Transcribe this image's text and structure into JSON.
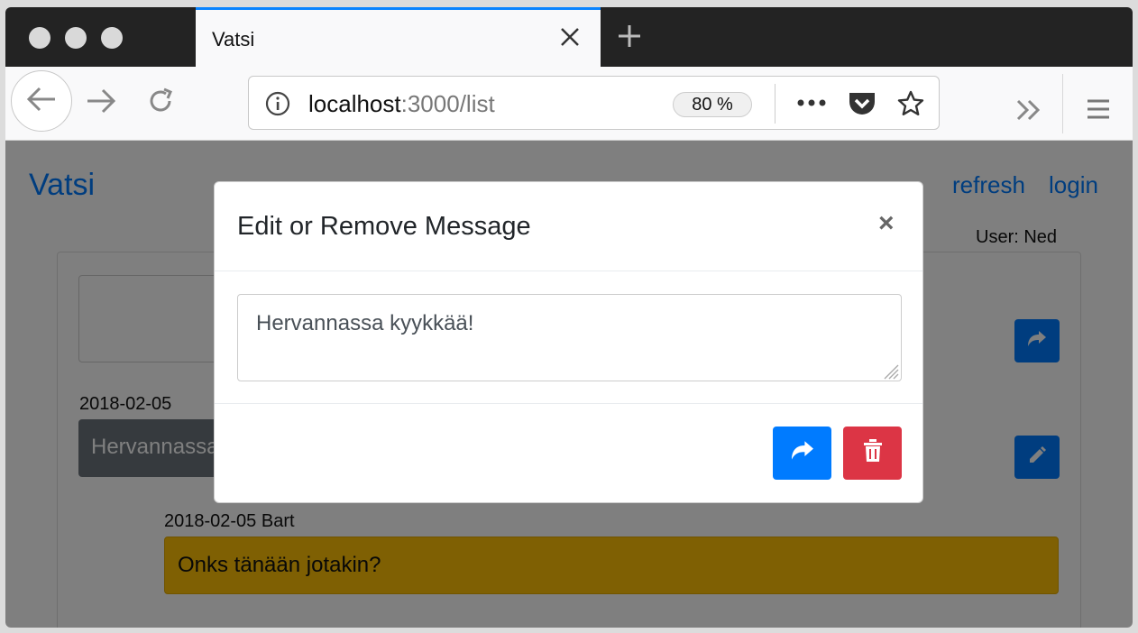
{
  "browser": {
    "tab_title": "Vatsi",
    "url_host": "localhost",
    "url_path": ":3000/list",
    "zoom": "80 %"
  },
  "page": {
    "brand": "Vatsi",
    "nav_links": [
      "refresh",
      "login"
    ],
    "user_label": "User: Ned",
    "messages": [
      {
        "date": "2018-02-05",
        "text": "Hervannassa kyykkää!"
      },
      {
        "date": "2018-02-05 Bart",
        "text": "Onks tänään jotakin?"
      }
    ]
  },
  "modal": {
    "title": "Edit or Remove Message",
    "close_symbol": "×",
    "textarea_value": "Hervannassa kyykkää!"
  },
  "colors": {
    "primary": "#007bff",
    "danger": "#dc3545",
    "warning": "#ffc107",
    "secondary": "#6c757d"
  },
  "icons": [
    "back-arrow-icon",
    "forward-arrow-icon",
    "reload-icon",
    "info-icon",
    "more-icon",
    "pocket-icon",
    "star-icon",
    "overflow-icon",
    "menu-icon",
    "share-icon",
    "pencil-icon",
    "trash-icon",
    "close-icon",
    "plus-icon"
  ]
}
